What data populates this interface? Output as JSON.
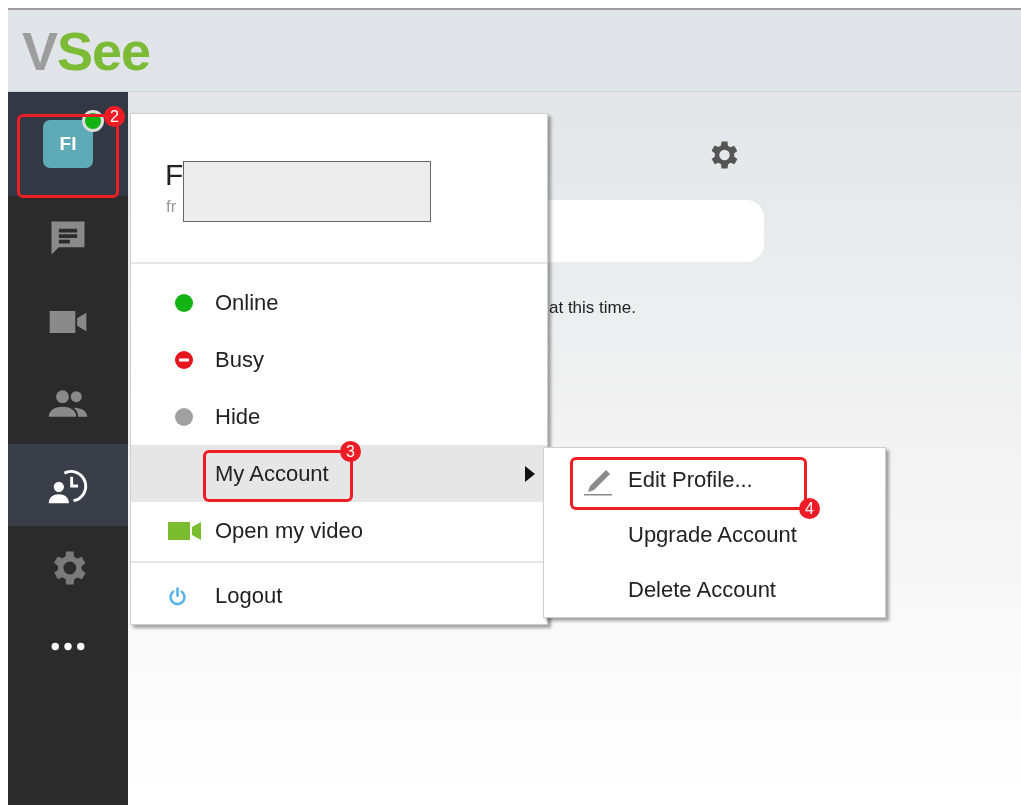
{
  "logo": {
    "first": "V",
    "rest": "See"
  },
  "sidebar": {
    "items": [
      {
        "kind": "avatar",
        "initials": "FI",
        "color": "#12b312",
        "selected": true
      },
      {
        "kind": "chat",
        "selected": false
      },
      {
        "kind": "video",
        "selected": false
      },
      {
        "kind": "contacts",
        "selected": false
      },
      {
        "kind": "history",
        "selected": true
      },
      {
        "kind": "settings",
        "selected": false
      },
      {
        "kind": "more",
        "selected": false
      }
    ]
  },
  "main": {
    "notice": "at this time."
  },
  "account_menu": {
    "name": "F",
    "email": "fr",
    "groups": [
      [
        {
          "kind": "status",
          "label": "Online",
          "color": "#12b312",
          "selected": false
        },
        {
          "kind": "busy",
          "label": "Busy",
          "color": "#e8141b",
          "selected": false
        },
        {
          "kind": "status",
          "label": "Hide",
          "color": "#a0a0a0",
          "selected": false
        },
        {
          "kind": "submenu",
          "label": "My Account",
          "selected": true
        },
        {
          "kind": "video",
          "label": "Open my video",
          "selected": false
        }
      ],
      [
        {
          "kind": "logout",
          "label": "Logout",
          "selected": false
        }
      ]
    ]
  },
  "account_submenu": {
    "items": [
      {
        "kind": "edit",
        "label": "Edit Profile..."
      },
      {
        "kind": "plain",
        "label": "Upgrade Account"
      },
      {
        "kind": "plain",
        "label": "Delete Account"
      }
    ]
  },
  "annotations": [
    {
      "number": "2"
    },
    {
      "number": "3"
    },
    {
      "number": "4"
    }
  ]
}
